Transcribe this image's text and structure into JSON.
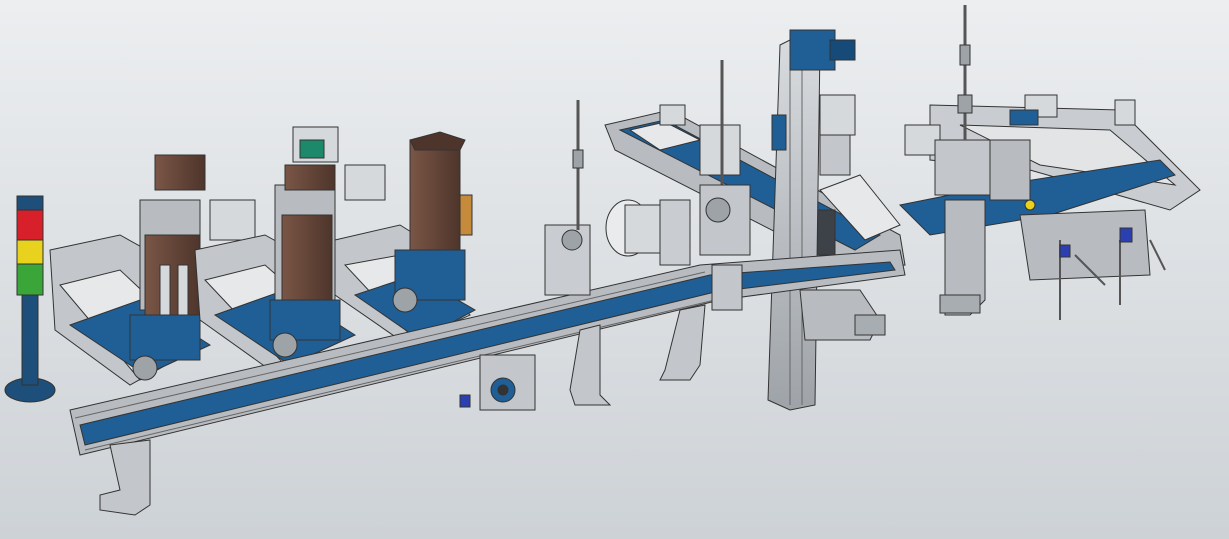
{
  "scene": {
    "subject": "conveyor-assembly-line-cad-model",
    "colors": {
      "background_top": "#eceef0",
      "background_bottom": "#cdd2d6",
      "belt_blue": "#1f5f96",
      "belt_dark": "#164a78",
      "steel": "#b8bcc0",
      "steel_light": "#d6d9dc",
      "steel_dark": "#8a8f94",
      "brown_hopper": "#6b4a3c",
      "brown_dark": "#4e352b",
      "signal_red": "#d8202a",
      "signal_yellow": "#e8d21e",
      "signal_green": "#3aa63a",
      "signal_base": "#1e4e7a",
      "outline": "#333333"
    },
    "icons": {
      "signal_tower": "signal-tower-icon",
      "motor": "motor-icon",
      "sensor": "sensor-icon"
    }
  }
}
